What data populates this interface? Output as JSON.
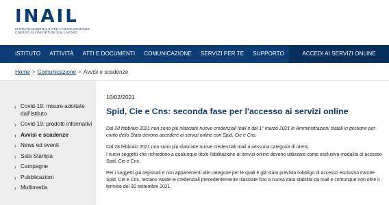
{
  "header": {
    "logo_text": "INAIL",
    "logo_subtitle_line1": "ISTITUTO NAZIONALE PER L'ASSICURAZIONE",
    "logo_subtitle_line2": "CONTRO GLI INFORTUNI SUL LAVORO"
  },
  "nav": {
    "items": [
      "Istituto",
      "Attività",
      "Atti e documenti",
      "Comunicazione",
      "Servizi per te",
      "Supporto"
    ],
    "cta_label": "Accedi ai servizi online"
  },
  "breadcrumb": {
    "home": "Home",
    "section": "Comunicazione",
    "current": "Avvisi e scadenze",
    "separator": ">"
  },
  "sidebar": {
    "items": [
      {
        "label": "Covid-19: misure adottate dall'Istituto",
        "active": false
      },
      {
        "label": "Covid-19: prodotti informativi",
        "active": false
      },
      {
        "label": "Avvisi e scadenze",
        "active": true
      },
      {
        "label": "News ed eventi",
        "active": false
      },
      {
        "label": "Sala Stampa",
        "active": false
      },
      {
        "label": "Campagne",
        "active": false
      },
      {
        "label": "Pubblicazioni",
        "active": false
      },
      {
        "label": "Multimedia",
        "active": false
      }
    ]
  },
  "article": {
    "date": "10/02/2021",
    "title": "Spid, Cie e Cns: seconda fase per l'accesso ai servizi online",
    "lead": "Dal 28 febbraio 2021 non sono più rilasciate nuove credenziali Inail e dal 1° marzo 2021 le Amministrazioni statali in gestione per conto dello Stato devono accedere ai servizi online con Spid, Cie e Cns.",
    "paragraph1": "Dal 28 febbraio 2021 non sono più rilasciate nuove credenziali Inail a nessuna categoria di utenti.",
    "paragraph2": "I nuovi soggetti che richiedono a qualunque titolo l'abilitazione ai servizi online devono utilizzare come esclusiva modalità di accesso Spid, Cie e Cns.",
    "paragraph3": "Per i soggetti già registrati e non appartenenti alle categorie per le quali è già stato previsto l'obbligo di accesso esclusivo tramite Spid, Cie e Cns, restano valide le credenziali precedentemente rilasciate fino a nuova data stabilita da Inail e comunque non oltre il termine del 30 settembre 2021."
  },
  "colors": {
    "brand_blue": "#0b3d74",
    "cta_blue": "#06305c",
    "sidebar_bg": "#eeeeee"
  }
}
